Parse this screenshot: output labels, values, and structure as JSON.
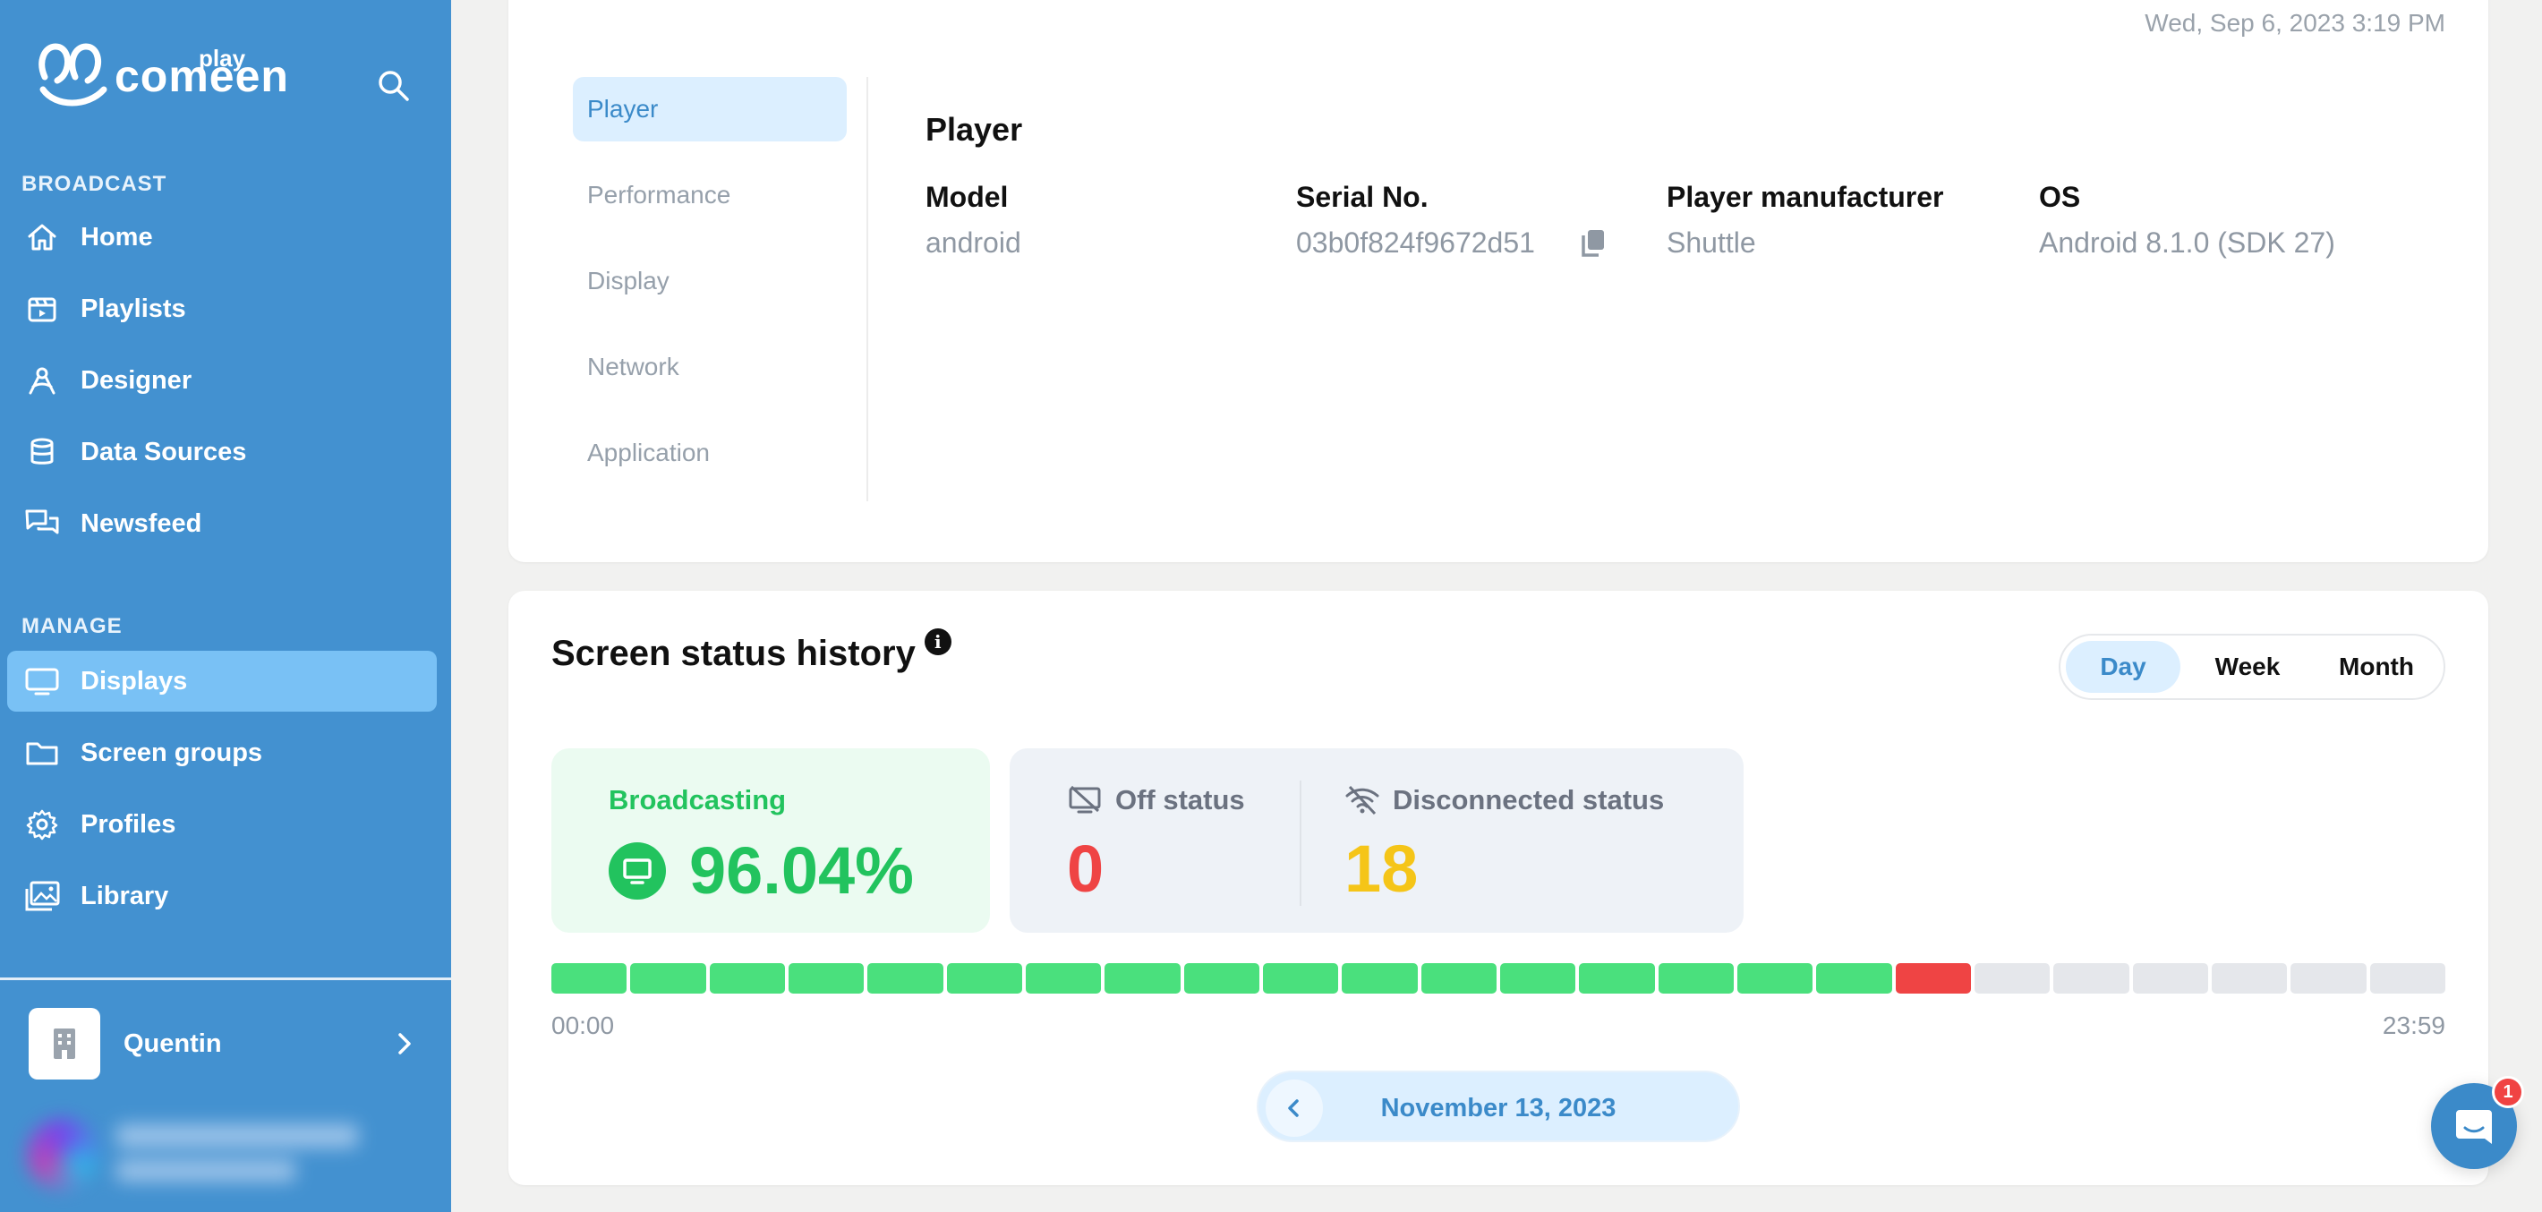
{
  "brand": {
    "name": "comeen",
    "sub": "play"
  },
  "sidebar": {
    "sections": [
      {
        "label": "BROADCAST",
        "items": [
          {
            "label": "Home",
            "icon": "home-icon"
          },
          {
            "label": "Playlists",
            "icon": "clapperboard-icon"
          },
          {
            "label": "Designer",
            "icon": "designer-icon"
          },
          {
            "label": "Data Sources",
            "icon": "database-icon"
          },
          {
            "label": "Newsfeed",
            "icon": "chat-bubbles-icon"
          }
        ]
      },
      {
        "label": "MANAGE",
        "items": [
          {
            "label": "Displays",
            "icon": "monitor-icon",
            "active": true
          },
          {
            "label": "Screen groups",
            "icon": "folder-icon"
          },
          {
            "label": "Profiles",
            "icon": "gear-icon"
          },
          {
            "label": "Library",
            "icon": "images-icon"
          }
        ]
      }
    ],
    "organization": {
      "name": "Quentin",
      "icon": "building-icon"
    }
  },
  "player_card": {
    "timestamp": "Wed, Sep 6, 2023 3:19 PM",
    "tabs": [
      {
        "label": "Player",
        "active": true
      },
      {
        "label": "Performance"
      },
      {
        "label": "Display"
      },
      {
        "label": "Network"
      },
      {
        "label": "Application"
      }
    ],
    "title": "Player",
    "fields": [
      {
        "key": "Model",
        "value": "android"
      },
      {
        "key": "Serial No.",
        "value": "03b0f824f9672d51",
        "copyable": true
      },
      {
        "key": "Player manufacturer",
        "value": "Shuttle"
      },
      {
        "key": "OS",
        "value": "Android 8.1.0 (SDK 27)"
      }
    ]
  },
  "status_history": {
    "title": "Screen status history",
    "info_glyph": "i",
    "range_options": [
      {
        "label": "Day",
        "active": true
      },
      {
        "label": "Week"
      },
      {
        "label": "Month"
      }
    ],
    "broadcasting": {
      "label": "Broadcasting",
      "value": "96.04%"
    },
    "off": {
      "label": "Off status",
      "value": "0"
    },
    "disconnected": {
      "label": "Disconnected status",
      "value": "18"
    },
    "timeline": [
      "on",
      "on",
      "on",
      "on",
      "on",
      "on",
      "on",
      "on",
      "on",
      "on",
      "on",
      "on",
      "on",
      "on",
      "on",
      "on",
      "on",
      "off",
      "none",
      "none",
      "none",
      "none",
      "none",
      "none"
    ],
    "timeline_start": "00:00",
    "timeline_end": "23:59",
    "date": "November 13, 2023"
  },
  "colors": {
    "sidebar": "#4391d0",
    "accent": "#3b8ac9",
    "on": "#4ae07d",
    "off": "#ef4444",
    "none": "#e5e7eb",
    "disconnected": "#f5c518"
  },
  "chat": {
    "badge": "1"
  }
}
